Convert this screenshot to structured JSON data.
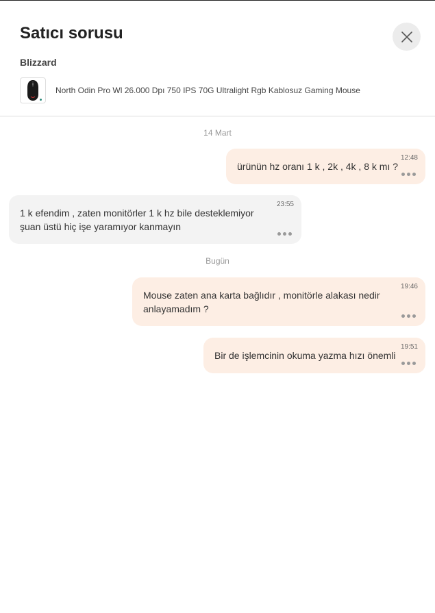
{
  "header": {
    "title": "Satıcı sorusu",
    "seller": "Blizzard",
    "product_name": "North Odin Pro Wl 26.000 Dpı 750 IPS 70G Ultralight Rgb Kablosuz Gaming Mouse",
    "product_icon": "mouse-product-thumbnail",
    "close_icon": "close-icon"
  },
  "conversation": {
    "separators": [
      "14 Mart",
      "Bugün"
    ],
    "messages": [
      {
        "side": "sent",
        "text": "ürünün hz oranı 1 k , 2k , 4k , 8 k mı ?",
        "time": "12:48"
      },
      {
        "side": "received",
        "text_line1": "1 k efendim , zaten monitörler 1 k hz bile desteklemiyor",
        "text_line2": "şuan üstü hiç işe yaramıyor kanmayın",
        "time": "23:55"
      },
      {
        "side": "sent",
        "text_line1": "Mouse zaten ana karta bağlıdır , monitörle alakası nedir",
        "text_line2": "anlayamadım ?",
        "time": "19:46"
      },
      {
        "side": "sent",
        "text": "Bir de işlemcinin okuma yazma hızı önemli",
        "time": "19:51"
      }
    ]
  },
  "colors": {
    "sent_bubble": "#fdeee4",
    "received_bubble": "#f3f3f3",
    "close_button_bg": "#ececec"
  }
}
